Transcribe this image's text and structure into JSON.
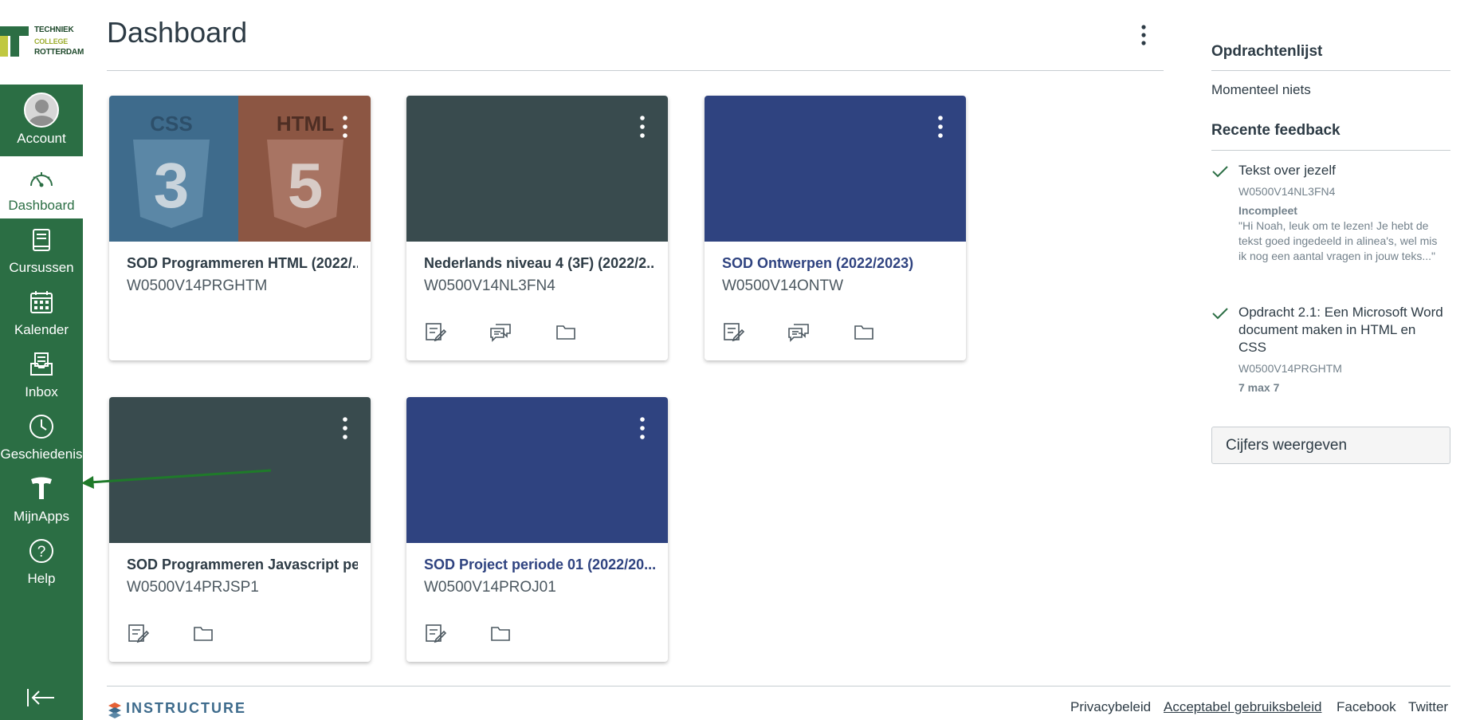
{
  "logo": {
    "line1": "TECHNIEK",
    "line2": "COLLEGE",
    "line3": "ROTTERDAM"
  },
  "sidebar": {
    "items": [
      {
        "label": "Account",
        "icon": "avatar"
      },
      {
        "label": "Dashboard",
        "icon": "speedometer-icon",
        "active": true
      },
      {
        "label": "Cursussen",
        "icon": "book-icon"
      },
      {
        "label": "Kalender",
        "icon": "calendar-icon"
      },
      {
        "label": "Inbox",
        "icon": "inbox-icon"
      },
      {
        "label": "Geschiedenis",
        "icon": "clock-icon"
      },
      {
        "label": "MijnApps",
        "icon": "app-icon"
      },
      {
        "label": "Help",
        "icon": "help-icon"
      }
    ]
  },
  "page": {
    "title": "Dashboard"
  },
  "cards": [
    {
      "title": "SOD Programmeren HTML (2022/...",
      "code": "W0500V14PRGHTM",
      "color": "#3e6b8c",
      "linked": false,
      "hero_left_text": "CSS",
      "hero_left_number": "3",
      "hero_right_text": "HTML",
      "hero_right_number": "5"
    },
    {
      "title": "Nederlands niveau 4 (3F) (2022/2...",
      "code": "W0500V14NL3FN4",
      "color": "#394b4e",
      "linked": false
    },
    {
      "title": "SOD Ontwerpen (2022/2023)",
      "code": "W0500V14ONTW",
      "color": "#2f4380",
      "linked": true
    },
    {
      "title": "SOD Programmeren Javascript per...",
      "code": "W0500V14PRJSP1",
      "color": "#394b4e",
      "linked": false
    },
    {
      "title": "SOD Project periode 01 (2022/20...",
      "code": "W0500V14PROJ01",
      "color": "#2f4380",
      "linked": true
    }
  ],
  "todo": {
    "heading": "Opdrachtenlijst",
    "empty_text": "Momenteel niets"
  },
  "feedback": {
    "heading": "Recente feedback",
    "items": [
      {
        "title": "Tekst over jezelf",
        "code": "W0500V14NL3FN4",
        "status": "Incompleet",
        "quote": "\"Hi Noah, leuk om te lezen! Je hebt de tekst goed ingedeeld in alinea's, wel mis ik nog een aantal vragen in jouw teks...\""
      },
      {
        "title": "Opdracht 2.1: Een Microsoft Word document maken in HTML en CSS",
        "code": "W0500V14PRGHTM",
        "score": "7 max 7"
      }
    ],
    "button": "Cijfers weergeven"
  },
  "footer": {
    "brand": "INSTRUCTURE",
    "links": [
      "Privacybeleid",
      "Acceptabel gebruiksbeleid",
      "Facebook",
      "Twitter"
    ]
  },
  "colors": {
    "sidebar": "#2b6e44",
    "link": "#2f4380",
    "annotation_arrow": "#1f7a2a"
  }
}
